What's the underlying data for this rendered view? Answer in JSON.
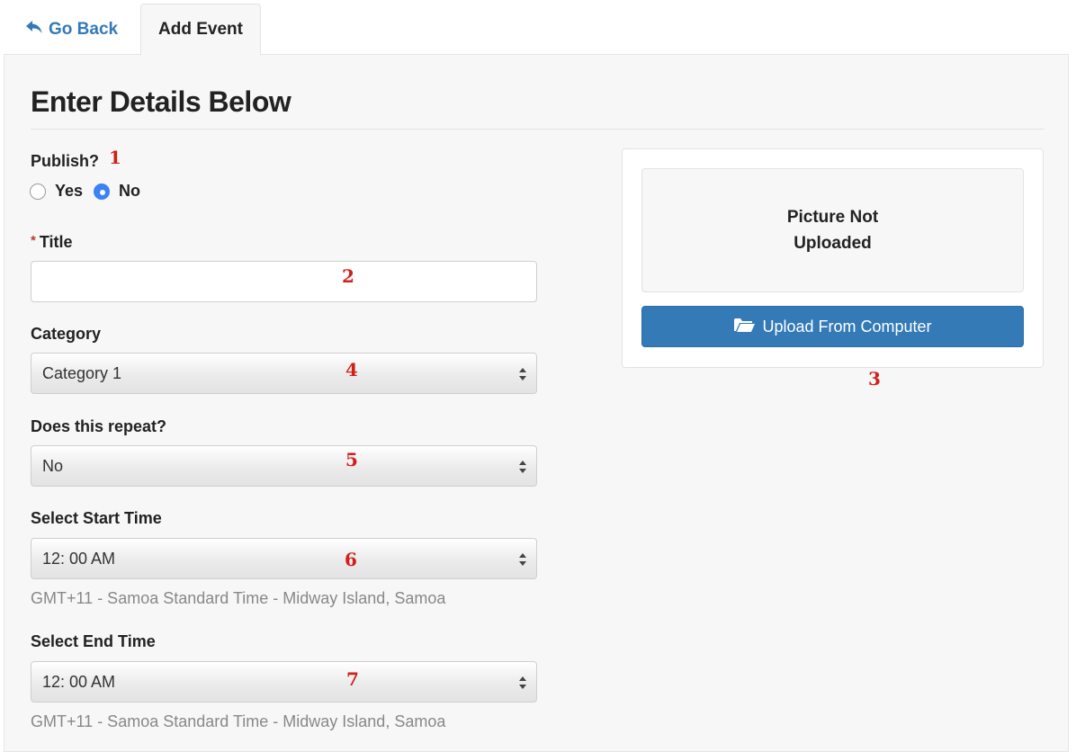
{
  "tabs": {
    "back_label": "Go Back",
    "active_label": "Add Event"
  },
  "form": {
    "heading": "Enter Details Below",
    "publish": {
      "label": "Publish?",
      "options": [
        "Yes",
        "No"
      ],
      "selected": "No"
    },
    "title": {
      "required_mark": "*",
      "label": "Title",
      "value": ""
    },
    "category": {
      "label": "Category",
      "selected": "Category 1"
    },
    "repeat": {
      "label": "Does this repeat?",
      "selected": "No"
    },
    "start_time": {
      "label": "Select Start Time",
      "selected": "12: 00 AM",
      "timezone_note": "GMT+11 - Samoa Standard Time - Midway Island, Samoa"
    },
    "end_time": {
      "label": "Select End Time",
      "selected": "12: 00 AM",
      "timezone_note": "GMT+11 - Samoa Standard Time - Midway Island, Samoa"
    }
  },
  "upload": {
    "preview_line1": "Picture Not",
    "preview_line2": "Uploaded",
    "button_label": "Upload From Computer"
  },
  "annotations": {
    "m1": "1",
    "m2": "2",
    "m3": "3",
    "m4": "4",
    "m5": "5",
    "m6": "6",
    "m7": "7"
  },
  "colors": {
    "link": "#337ab7",
    "primary_button": "#337ab7",
    "radio_checked": "#3b82f6",
    "annotation_marker": "#d0201b",
    "required_mark": "#c0392b"
  },
  "icons": {
    "back": "reply-arrow-icon",
    "upload": "folder-open-icon",
    "select_arrows": "sort-arrows-icon"
  }
}
